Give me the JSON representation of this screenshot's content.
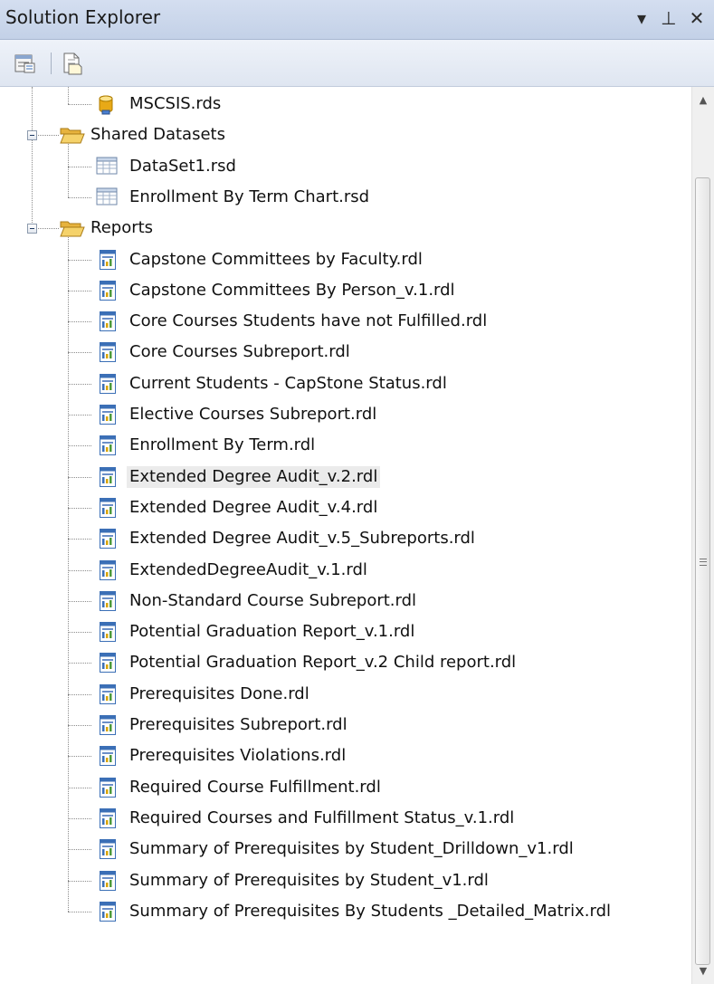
{
  "window": {
    "title": "Solution Explorer",
    "controls": {
      "dropdown": "▾",
      "pin": "⊥",
      "close": "✕"
    }
  },
  "toolbar": {
    "buttons": [
      {
        "name": "properties-icon"
      },
      {
        "name": "show-all-files-icon"
      }
    ]
  },
  "tree": {
    "items": [
      {
        "label": "MSCSIS.rds",
        "icon": "datasource-icon",
        "level": 2
      },
      {
        "label": "Shared Datasets",
        "icon": "folder-open-icon",
        "level": 1,
        "expanded": true
      },
      {
        "label": "DataSet1.rsd",
        "icon": "dataset-icon",
        "level": 2
      },
      {
        "label": "Enrollment By Term Chart.rsd",
        "icon": "dataset-icon",
        "level": 2
      },
      {
        "label": "Reports",
        "icon": "folder-open-icon",
        "level": 1,
        "expanded": true
      },
      {
        "label": "Capstone Committees by Faculty.rdl",
        "icon": "report-icon",
        "level": 2
      },
      {
        "label": "Capstone Committees By Person_v.1.rdl",
        "icon": "report-icon",
        "level": 2
      },
      {
        "label": "Core Courses Students have not Fulfilled.rdl",
        "icon": "report-icon",
        "level": 2
      },
      {
        "label": "Core Courses Subreport.rdl",
        "icon": "report-icon",
        "level": 2
      },
      {
        "label": "Current Students - CapStone Status.rdl",
        "icon": "report-icon",
        "level": 2
      },
      {
        "label": "Elective Courses Subreport.rdl",
        "icon": "report-icon",
        "level": 2
      },
      {
        "label": "Enrollment By Term.rdl",
        "icon": "report-icon",
        "level": 2
      },
      {
        "label": "Extended Degree Audit_v.2.rdl",
        "icon": "report-icon",
        "level": 2,
        "selected": true
      },
      {
        "label": "Extended Degree Audit_v.4.rdl",
        "icon": "report-icon",
        "level": 2
      },
      {
        "label": "Extended Degree Audit_v.5_Subreports.rdl",
        "icon": "report-icon",
        "level": 2
      },
      {
        "label": "ExtendedDegreeAudit_v.1.rdl",
        "icon": "report-icon",
        "level": 2
      },
      {
        "label": "Non-Standard Course Subreport.rdl",
        "icon": "report-icon",
        "level": 2
      },
      {
        "label": "Potential Graduation Report_v.1.rdl",
        "icon": "report-icon",
        "level": 2
      },
      {
        "label": "Potential Graduation Report_v.2 Child report.rdl",
        "icon": "report-icon",
        "level": 2
      },
      {
        "label": "Prerequisites Done.rdl",
        "icon": "report-icon",
        "level": 2
      },
      {
        "label": "Prerequisites Subreport.rdl",
        "icon": "report-icon",
        "level": 2
      },
      {
        "label": "Prerequisites Violations.rdl",
        "icon": "report-icon",
        "level": 2
      },
      {
        "label": "Required Course Fulfillment.rdl",
        "icon": "report-icon",
        "level": 2
      },
      {
        "label": "Required Courses and Fulfillment Status_v.1.rdl",
        "icon": "report-icon",
        "level": 2
      },
      {
        "label": "Summary of Prerequisites by Student_Drilldown_v1.rdl",
        "icon": "report-icon",
        "level": 2
      },
      {
        "label": "Summary of Prerequisites by Student_v1.rdl",
        "icon": "report-icon",
        "level": 2
      },
      {
        "label": "Summary of Prerequisites By Students _Detailed_Matrix.rdl",
        "icon": "report-icon",
        "level": 2
      }
    ]
  },
  "scrollbar": {
    "up_arrow": "▲",
    "down_arrow": "▼"
  },
  "colors": {
    "titlebar": "#c3d1e7",
    "selection": "#ebebeb",
    "folder": "#f2c14e",
    "report": "#3b6fb6",
    "datasource": "#e0a100"
  }
}
